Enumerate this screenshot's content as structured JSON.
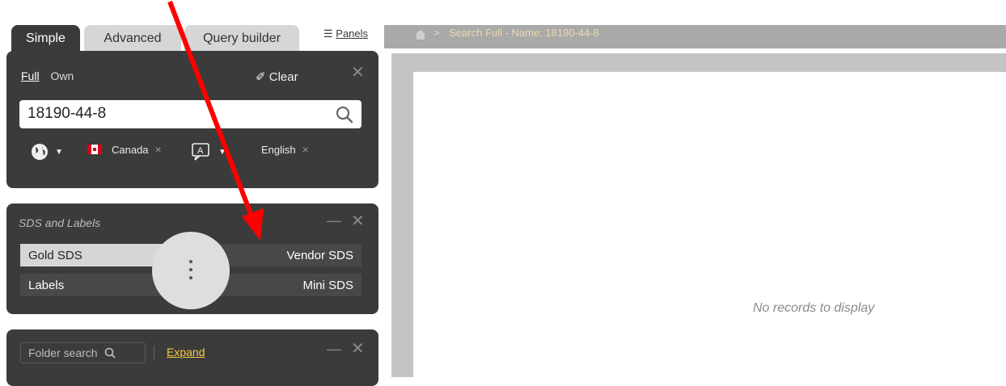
{
  "tabs": [
    {
      "label": "Simple",
      "active": true
    },
    {
      "label": "Advanced",
      "active": false
    },
    {
      "label": "Query builder",
      "active": false
    }
  ],
  "panels_link": "Panels",
  "search_panel": {
    "mode_full": "Full",
    "mode_own": "Own",
    "clear_label": "Clear",
    "search_value": "18190-44-8",
    "country_label": "Canada",
    "language_label": "English",
    "chip_remove": "×",
    "close": "✕"
  },
  "sds_panel": {
    "title": "SDS and Labels",
    "minimize": "—",
    "close": "✕",
    "buttons": {
      "gold_sds": "Gold SDS",
      "vendor_sds": "Vendor SDS",
      "labels": "Labels",
      "mini_sds": "Mini SDS"
    }
  },
  "folder_panel": {
    "search_label": "Folder search",
    "expand_label": "Expand",
    "minimize": "—",
    "close": "✕"
  },
  "breadcrumb": {
    "separator": ">",
    "text": "Search Full - Name: 18190-44-8"
  },
  "content": {
    "empty_message": "No records to display"
  },
  "colors": {
    "panel_bg": "#3b3b3b",
    "accent_yellow": "#f5c842",
    "annotation_arrow": "#ff0000"
  }
}
